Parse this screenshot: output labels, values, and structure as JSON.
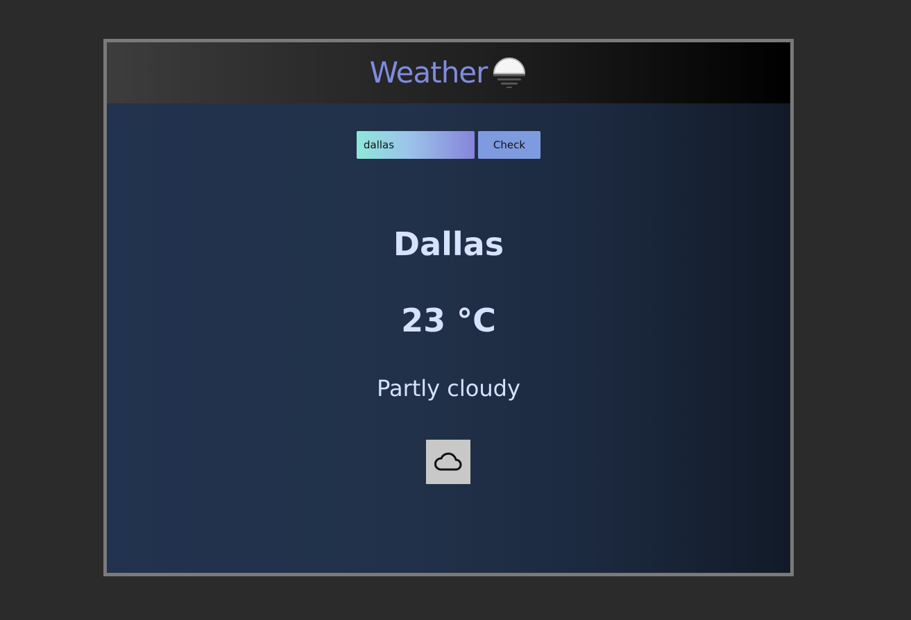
{
  "header": {
    "title": "Weather",
    "icon": "sunset-icon"
  },
  "search": {
    "value": "dallas",
    "button_label": "Check"
  },
  "weather": {
    "city": "Dallas",
    "temperature": "23 °C",
    "condition": "Partly cloudy",
    "condition_icon": "cloud-icon"
  },
  "colors": {
    "title": "#7f8ce0",
    "text": "#d7e2ff",
    "button": "#7f9be0"
  }
}
